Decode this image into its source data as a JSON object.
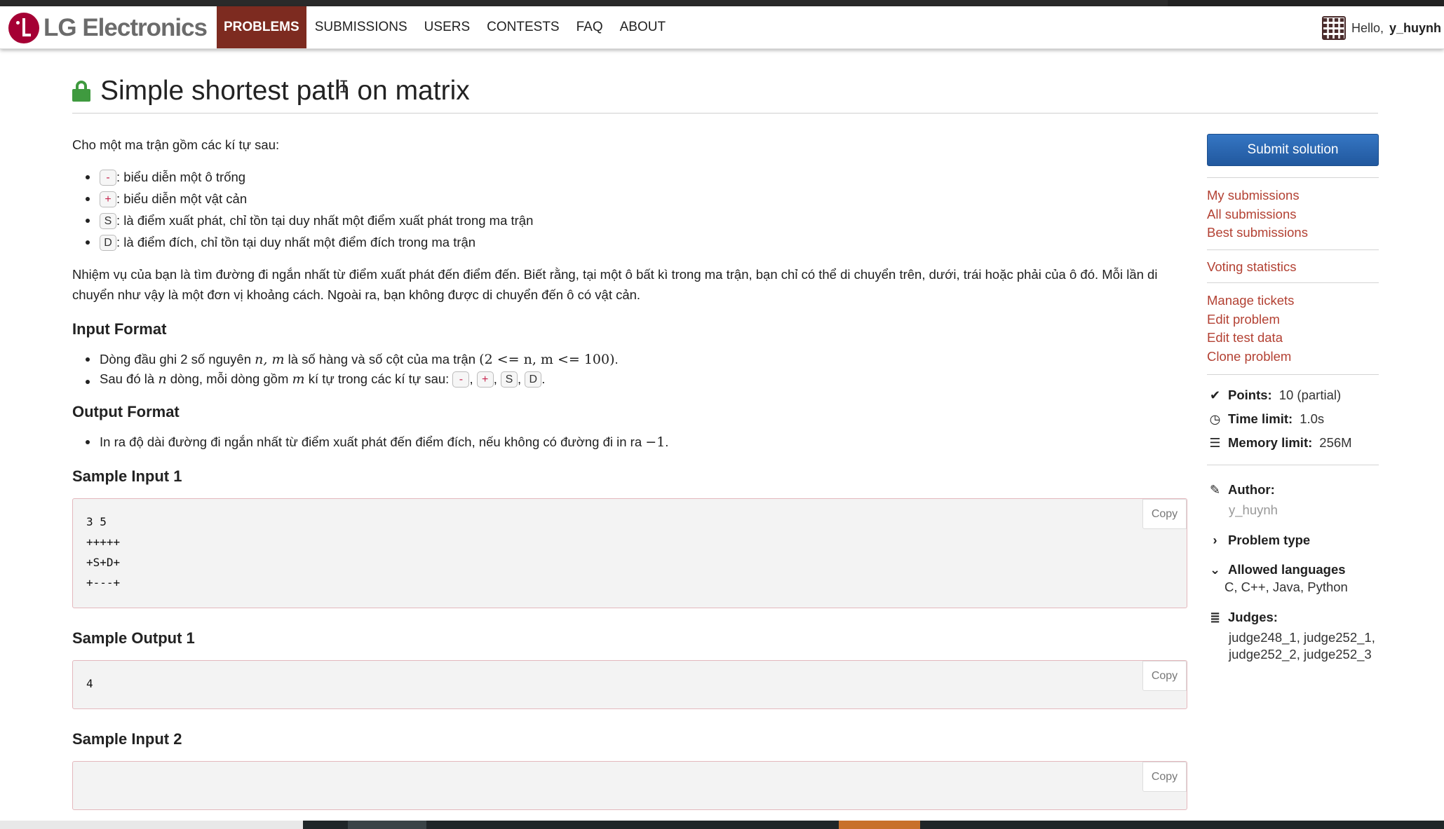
{
  "brand": {
    "name": "LG Electronics"
  },
  "nav": {
    "items": [
      "PROBLEMS",
      "SUBMISSIONS",
      "USERS",
      "CONTESTS",
      "FAQ",
      "ABOUT"
    ],
    "active": "PROBLEMS"
  },
  "user": {
    "greeting": "Hello,",
    "username": "y_huynh"
  },
  "problem": {
    "title": "Simple shortest path on matrix",
    "intro": "Cho một ma trận gồm các kí tự sau:",
    "chars": [
      {
        "symbol": "-",
        "text": ": biểu diễn một ô trống"
      },
      {
        "symbol": "+",
        "text": ": biểu diễn một vật cản"
      },
      {
        "symbol": "S",
        "text": ": là điểm xuất phát, chỉ tồn tại duy nhất một điểm xuất phát trong ma trận"
      },
      {
        "symbol": "D",
        "text": ": là điểm đích, chỉ tồn tại duy nhất một điểm đích trong ma trận"
      }
    ],
    "task": "Nhiệm vụ của bạn là tìm đường đi ngắn nhất từ điểm xuất phát đến điểm đến. Biết rằng, tại một ô bất kì trong ma trận, bạn chỉ có thể di chuyển trên, dưới, trái hoặc phải của ô đó. Mỗi lần di chuyển như vậy là một đơn vị khoảng cách. Ngoài ra, bạn không được di chuyển đến ô có vật cản.",
    "input_format": {
      "heading": "Input Format",
      "line1_prefix": "Dòng đầu ghi 2 số nguyên ",
      "line1_vars": "n, m",
      "line1_mid": " là số hàng và số cột của ma trận ",
      "line1_math": "(2 <= n, m <= 100)",
      "line1_suffix": ".",
      "line2_prefix": "Sau đó là ",
      "line2_var1": "n",
      "line2_mid": " dòng, mỗi dòng gồm ",
      "line2_var2": "m",
      "line2_suffix": " kí tự trong các kí tự sau: ",
      "line2_symbols": [
        "-",
        "+",
        "S",
        "D"
      ],
      "line2_end": "."
    },
    "output_format": {
      "heading": "Output Format",
      "line_prefix": "In ra độ dài đường đi ngắn nhất từ điểm xuất phát đến điểm đích, nếu không có đường đi in ra ",
      "line_math": "−1",
      "line_suffix": "."
    },
    "samples": [
      {
        "heading": "Sample Input 1",
        "content": "3 5\n+++++\n+S+D+\n+---+",
        "copy": "Copy"
      },
      {
        "heading": "Sample Output 1",
        "content": "4",
        "copy": "Copy"
      },
      {
        "heading": "Sample Input 2",
        "content": "",
        "copy": "Copy"
      }
    ]
  },
  "sidebar": {
    "submit": "Submit solution",
    "links1": [
      "My submissions",
      "All submissions",
      "Best submissions"
    ],
    "links2": [
      "Voting statistics"
    ],
    "links3": [
      "Manage tickets",
      "Edit problem",
      "Edit test data",
      "Clone problem"
    ],
    "points_label": "Points:",
    "points_value": "10 (partial)",
    "time_label": "Time limit:",
    "time_value": "1.0s",
    "memory_label": "Memory limit:",
    "memory_value": "256M",
    "author_label": "Author:",
    "author_value": "y_huynh",
    "problem_type_label": "Problem type",
    "languages_label": "Allowed languages",
    "languages_value": "C, C++, Java, Python",
    "judges_label": "Judges:",
    "judges_line1": "judge248_1, judge252_1,",
    "judges_line2": "judge252_2, judge252_3"
  }
}
